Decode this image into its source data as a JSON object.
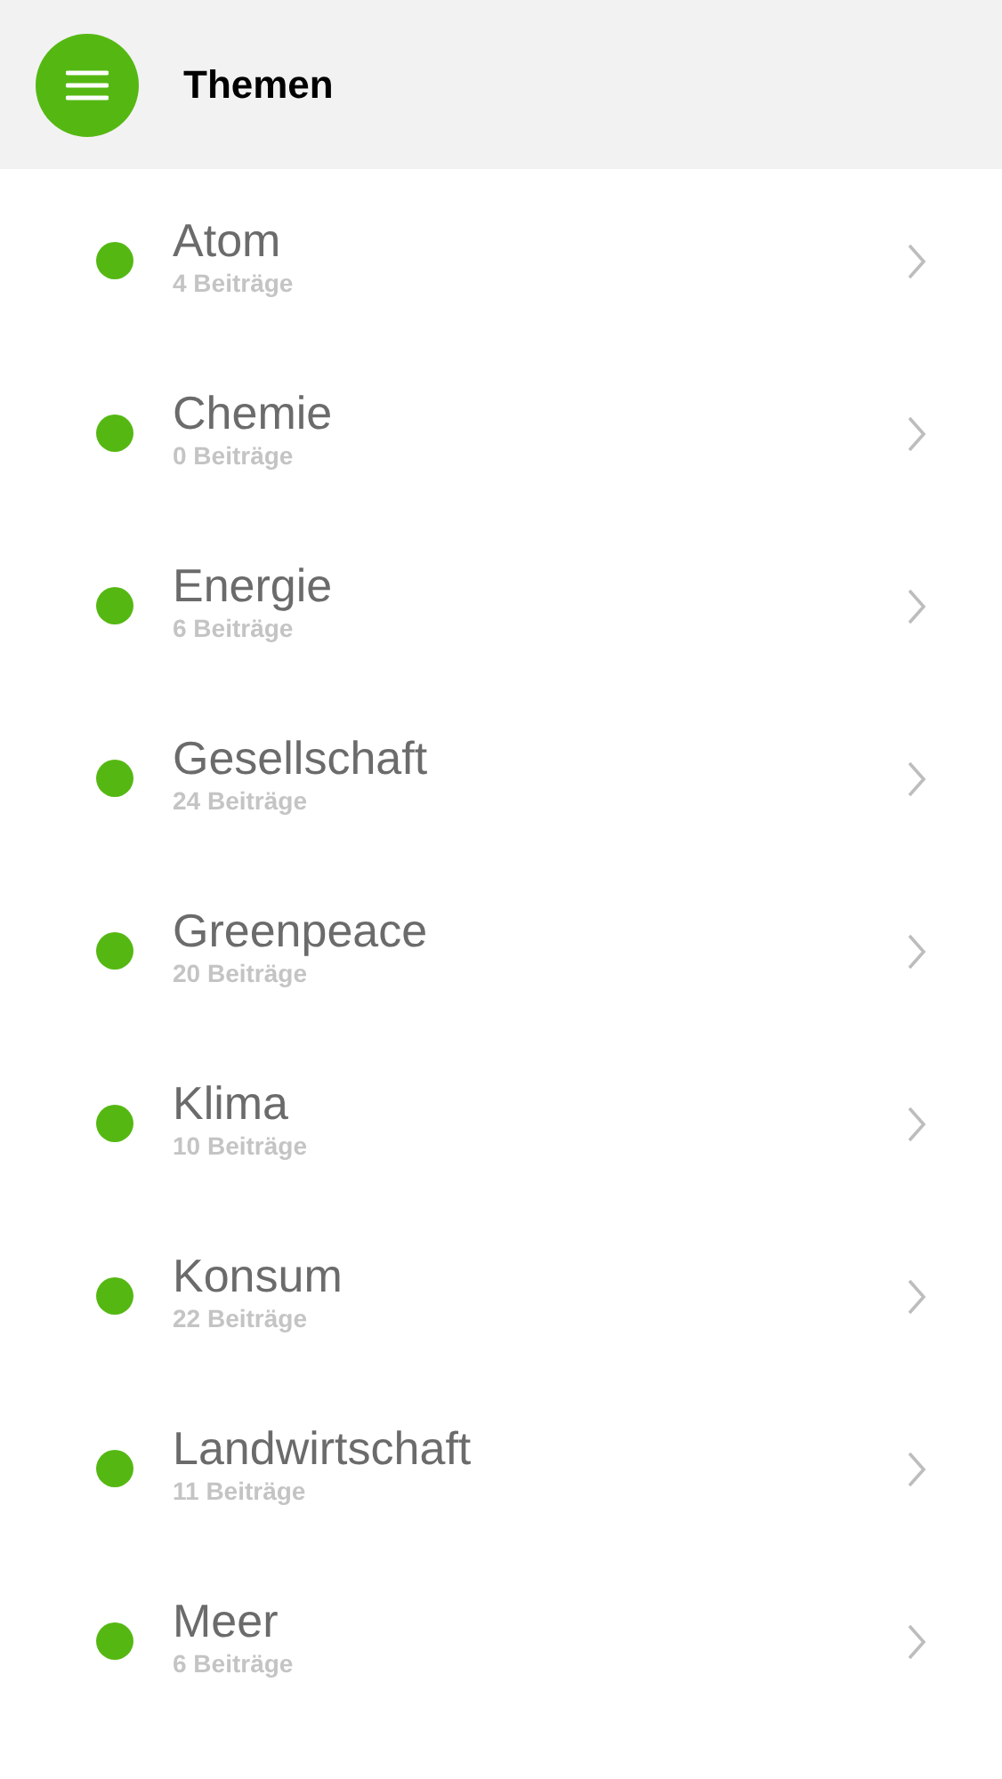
{
  "header": {
    "title": "Themen"
  },
  "topics": [
    {
      "name": "Atom",
      "count": "4 Beiträge"
    },
    {
      "name": "Chemie",
      "count": "0 Beiträge"
    },
    {
      "name": "Energie",
      "count": "6 Beiträge"
    },
    {
      "name": "Gesellschaft",
      "count": "24 Beiträge"
    },
    {
      "name": "Greenpeace",
      "count": "20 Beiträge"
    },
    {
      "name": "Klima",
      "count": "10 Beiträge"
    },
    {
      "name": "Konsum",
      "count": "22 Beiträge"
    },
    {
      "name": "Landwirtschaft",
      "count": "11 Beiträge"
    },
    {
      "name": "Meer",
      "count": "6 Beiträge"
    }
  ]
}
